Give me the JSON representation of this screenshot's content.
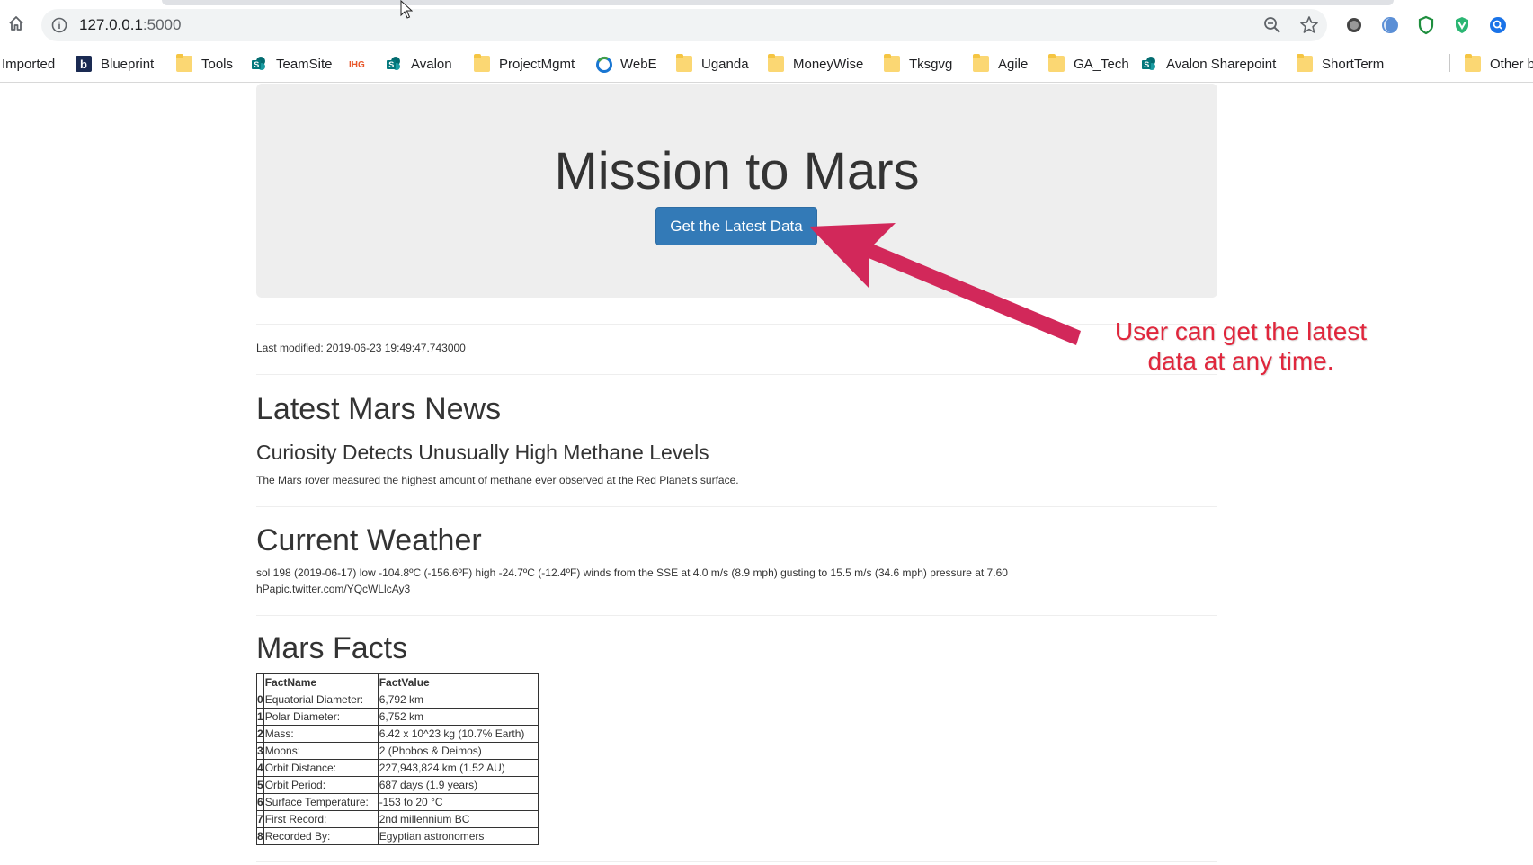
{
  "browser": {
    "url_host": "127.0.0.1",
    "url_port": ":5000",
    "bookmarks": [
      {
        "label": "Imported",
        "icon": "none"
      },
      {
        "label": "Blueprint",
        "icon": "blueprint-b-icon"
      },
      {
        "label": "Tools",
        "icon": "folder-icon"
      },
      {
        "label": "TeamSite",
        "icon": "sharepoint-icon"
      },
      {
        "label": "",
        "icon": "ihg-logo-icon"
      },
      {
        "label": "Avalon",
        "icon": "sharepoint-icon"
      },
      {
        "label": "ProjectMgmt",
        "icon": "folder-icon"
      },
      {
        "label": "WebE",
        "icon": "webe-ring-icon"
      },
      {
        "label": "Uganda",
        "icon": "folder-icon"
      },
      {
        "label": "MoneyWise",
        "icon": "folder-icon"
      },
      {
        "label": "Tksgvg",
        "icon": "folder-icon"
      },
      {
        "label": "Agile",
        "icon": "folder-icon"
      },
      {
        "label": "GA_Tech",
        "icon": "folder-icon"
      },
      {
        "label": "Avalon Sharepoint",
        "icon": "sharepoint-icon"
      },
      {
        "label": "ShortTerm",
        "icon": "folder-icon"
      },
      {
        "label": "Other b",
        "icon": "folder-icon"
      }
    ],
    "ihg_logo_text": "IHG"
  },
  "header": {
    "title": "Mission to Mars",
    "button_label": "Get the Latest Data"
  },
  "last_modified": "Last modified: 2019-06-23 19:49:47.743000",
  "news": {
    "heading": "Latest Mars News",
    "title": "Curiosity Detects Unusually High Methane Levels",
    "paragraph": "The Mars rover measured the highest amount of methane ever observed at the Red Planet's surface."
  },
  "weather": {
    "heading": "Current Weather",
    "line1": "sol 198 (2019-06-17) low -104.8ºC (-156.6ºF) high -24.7ºC (-12.4ºF) winds from the SSE at 4.0 m/s (8.9 mph) gusting to 15.5 m/s (34.6 mph) pressure at 7.60",
    "line2": "hPapic.twitter.com/YQcWLlcAy3"
  },
  "facts": {
    "heading": "Mars Facts",
    "columns": [
      "",
      "FactName",
      "FactValue"
    ],
    "rows": [
      [
        "0",
        "Equatorial Diameter:",
        "6,792 km"
      ],
      [
        "1",
        "Polar Diameter:",
        "6,752 km"
      ],
      [
        "2",
        "Mass:",
        "6.42 x 10^23 kg (10.7% Earth)"
      ],
      [
        "3",
        "Moons:",
        "2 (Phobos & Deimos)"
      ],
      [
        "4",
        "Orbit Distance:",
        "227,943,824 km (1.52 AU)"
      ],
      [
        "5",
        "Orbit Period:",
        "687 days (1.9 years)"
      ],
      [
        "6",
        "Surface Temperature:",
        "-153 to 20 °C"
      ],
      [
        "7",
        "First Record:",
        "2nd millennium BC"
      ],
      [
        "8",
        "Recorded By:",
        "Egyptian astronomers"
      ]
    ]
  },
  "annotation": {
    "line1": "User can get the latest",
    "line2": "data at any time.",
    "color": "#e0263c"
  },
  "colors": {
    "primary_button": "#337ab7",
    "jumbotron_bg": "#eeeeee"
  }
}
